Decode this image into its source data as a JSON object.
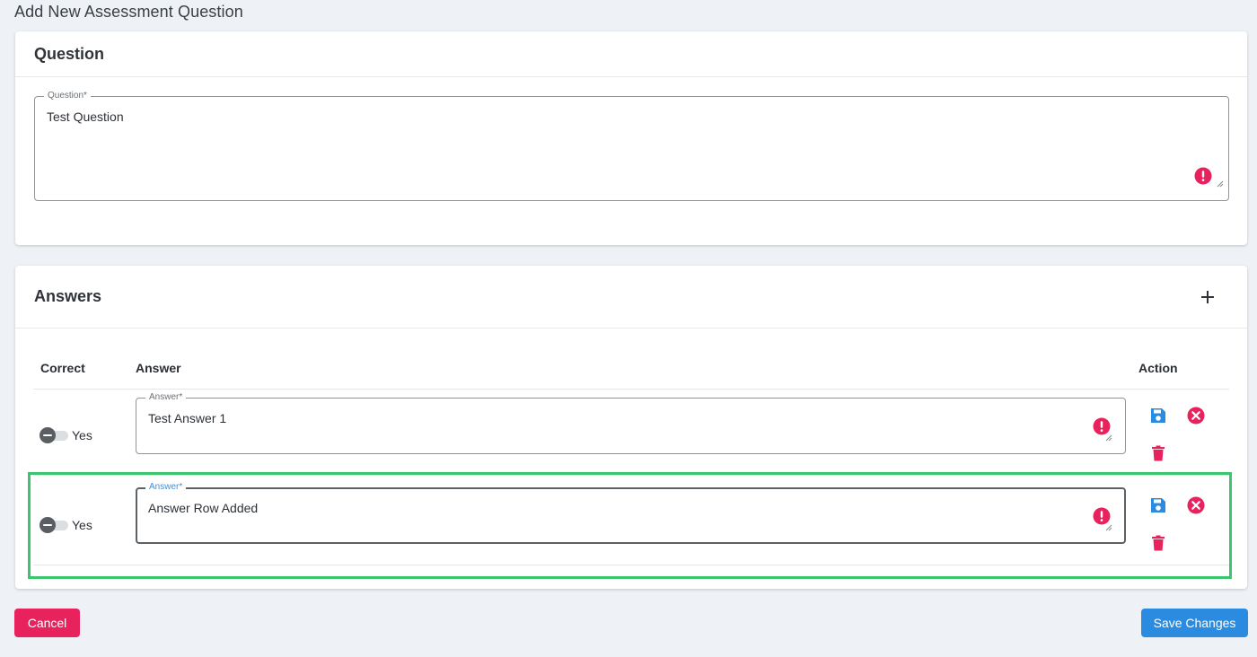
{
  "page": {
    "title": "Add New Assessment Question"
  },
  "question_card": {
    "header": "Question",
    "field": {
      "label": "Question*",
      "value": "Test Question"
    }
  },
  "answers_card": {
    "header": "Answers",
    "add_icon": "plus-icon",
    "columns": {
      "correct": "Correct",
      "answer": "Answer",
      "action": "Action"
    },
    "rows": [
      {
        "correct_label": "Yes",
        "field_label": "Answer*",
        "value": "Test Answer 1",
        "focused": false
      },
      {
        "correct_label": "Yes",
        "field_label": "Answer*",
        "value": "Answer Row Added",
        "focused": true
      }
    ]
  },
  "footer": {
    "cancel_label": "Cancel",
    "save_label": "Save Changes"
  },
  "colors": {
    "error": "#e8225d",
    "save_icon": "#2a8be0",
    "delete_icon": "#e8225d",
    "cancel_bg": "#e8225d",
    "save_bg": "#2a8be0",
    "highlight": "#3cc46f"
  }
}
